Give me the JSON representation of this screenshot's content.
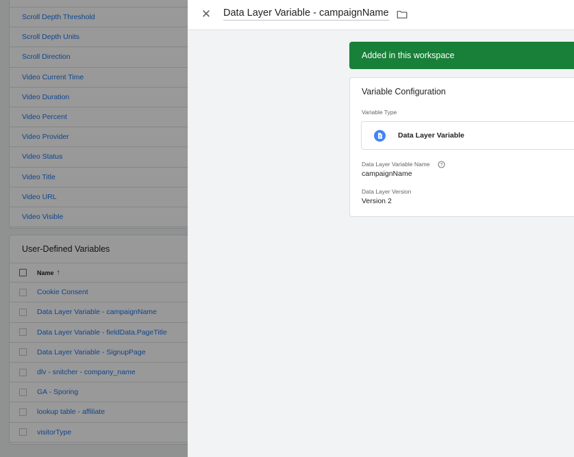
{
  "builtin_variables": {
    "items": [
      "",
      "Scroll Depth Threshold",
      "Scroll Depth Units",
      "Scroll Direction",
      "Video Current Time",
      "Video Duration",
      "Video Percent",
      "Video Provider",
      "Video Status",
      "Video Title",
      "Video URL",
      "Video Visible"
    ]
  },
  "user_defined": {
    "title": "User-Defined Variables",
    "column_name": "Name",
    "sort_indicator": "↑",
    "rows": [
      "Cookie Consent",
      "Data Layer Variable - campaignName",
      "Data Layer Variable - fieldData.PageTitle",
      "Data Layer Variable - SignupPage",
      "dlv - snitcher - company_name",
      "GA - Sporing",
      "lookup table - affiliate",
      "visitorType"
    ]
  },
  "panel": {
    "close_glyph": "✕",
    "title": "Data Layer Variable - campaignName",
    "banner": "Added in this workspace",
    "config": {
      "title": "Variable Configuration",
      "type_label": "Variable Type",
      "type_value": "Data Layer Variable",
      "name_label": "Data Layer Variable Name",
      "name_value": "campaignName",
      "version_label": "Data Layer Version",
      "version_value": "Version 2"
    }
  },
  "colors": {
    "banner_green": "#188038",
    "link_blue": "#1a73e8",
    "doc_icon_blue": "#4285f4"
  },
  "icons": {
    "close": "close-icon",
    "folder": "folder-icon",
    "variable_type": "document-icon",
    "help": "help-icon"
  }
}
